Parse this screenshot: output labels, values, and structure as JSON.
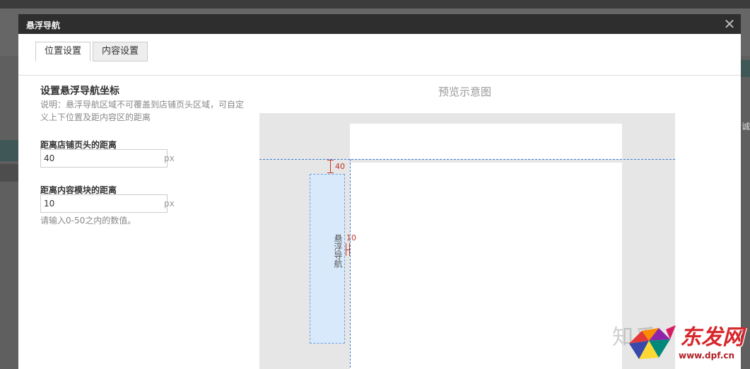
{
  "modal": {
    "title": "悬浮导航",
    "close_glyph": "✕"
  },
  "tabs": [
    {
      "label": "位置设置",
      "active": true
    },
    {
      "label": "内容设置",
      "active": false
    }
  ],
  "form": {
    "heading": "设置悬浮导航坐标",
    "note": "说明：悬浮导航区域不可覆盖到店铺页头区域，可自定义上下位置及距内容区的距离",
    "fields": [
      {
        "label": "距离店铺页头的距离",
        "value": "40",
        "unit": "px"
      },
      {
        "label": "距离内容模块的距离",
        "value": "10",
        "unit": "px"
      }
    ],
    "hint": "请输入0-50之内的数值。"
  },
  "preview": {
    "title": "预览示意图",
    "float_nav_label": "悬浮导航",
    "top_distance_label": "40",
    "side_distance_label": "10"
  },
  "background": {
    "right_edge_text": "诚"
  },
  "watermark": {
    "zhihu": "知乎",
    "brand": "东发网",
    "url": "www.dpf.cn"
  },
  "colors": {
    "header_bg": "#2e2e2e",
    "guide_blue": "#3b7ed6",
    "dimension_red": "#c0392b",
    "float_nav_fill": "#d8e9fb"
  }
}
